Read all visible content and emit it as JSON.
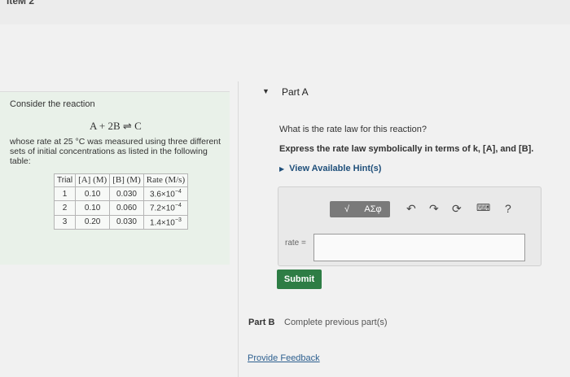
{
  "top_fragment": "iteM 2",
  "problem": {
    "intro": "Consider the reaction",
    "equation": "A + 2B ⇌ C",
    "description": "whose rate at 25 °C was measured using three different sets of initial concentrations as listed in the following table:",
    "table": {
      "headers": {
        "trial": "Trial",
        "a": "[A] (M)",
        "b": "[B] (M)",
        "rate": "Rate (M/s)"
      },
      "rows": [
        {
          "trial": "1",
          "a": "0.10",
          "b": "0.030",
          "rate_base": "3.6×10",
          "rate_exp": "−4"
        },
        {
          "trial": "2",
          "a": "0.10",
          "b": "0.060",
          "rate_base": "7.2×10",
          "rate_exp": "−4"
        },
        {
          "trial": "3",
          "a": "0.20",
          "b": "0.030",
          "rate_base": "1.4×10",
          "rate_exp": "−3"
        }
      ]
    }
  },
  "part_a": {
    "header": "Part A",
    "question": "What is the rate law for this reaction?",
    "instruction": "Express the rate law symbolically in terms of k, [A], and [B].",
    "hints_label": "View Available Hint(s)",
    "toolbar": {
      "templates": "√",
      "greek": "ΑΣφ",
      "help": "?"
    },
    "rate_label": "rate =",
    "rate_value": "",
    "submit_label": "Submit"
  },
  "part_b": {
    "label": "Part B",
    "text": "Complete previous part(s)"
  },
  "feedback_link": "Provide Feedback"
}
